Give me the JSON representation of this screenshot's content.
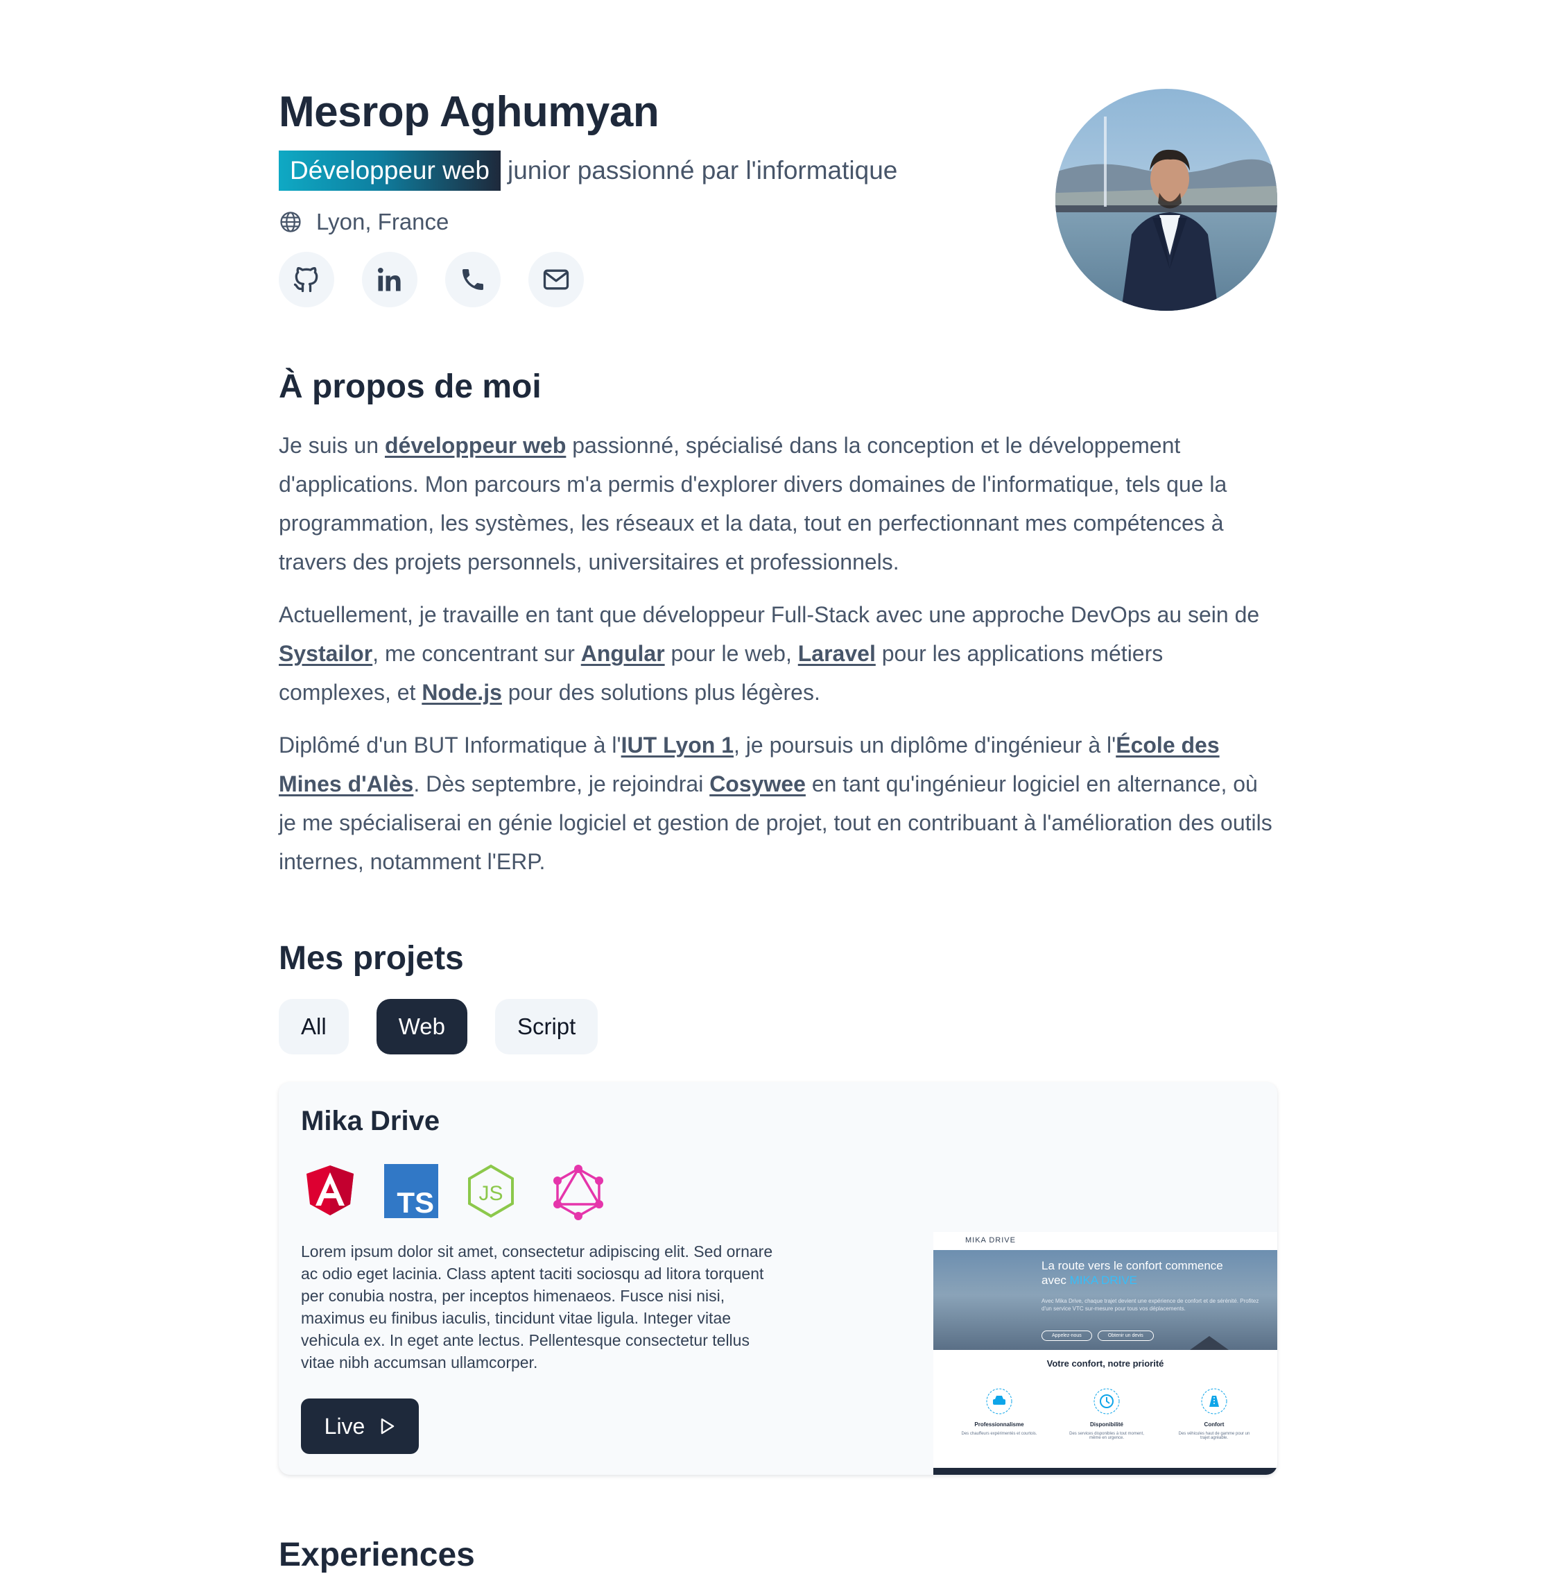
{
  "header": {
    "name": "Mesrop Aghumyan",
    "role_highlight": "Développeur web",
    "role_rest": "junior passionné par l'informatique",
    "location": "Lyon, France"
  },
  "socials": [
    {
      "icon": "github-icon"
    },
    {
      "icon": "linkedin-icon"
    },
    {
      "icon": "phone-icon"
    },
    {
      "icon": "mail-icon"
    }
  ],
  "about": {
    "title": "À propos de moi",
    "p1": {
      "t1": "Je suis un ",
      "l1": "développeur web",
      "t2": " passionné, spécialisé dans la conception et le développement d'applications. Mon parcours m'a permis d'explorer divers domaines de l'informatique, tels que la programmation, les systèmes, les réseaux et la data, tout en perfectionnant mes compétences à travers des projets personnels, universitaires et professionnels."
    },
    "p2": {
      "t1": "Actuellement, je travaille en tant que développeur Full-Stack avec une approche DevOps au sein de ",
      "l1": "Systailor",
      "t2": ", me concentrant sur ",
      "l2": "Angular",
      "t3": " pour le web, ",
      "l3": "Laravel",
      "t4": " pour les applications métiers complexes, et ",
      "l4": "Node.js",
      "t5": " pour des solutions plus légères."
    },
    "p3": {
      "t1": "Diplômé d'un BUT Informatique à l'",
      "l1": "IUT Lyon 1",
      "t2": ", je poursuis un diplôme d'ingénieur à l'",
      "l2": "École des Mines d'Alès",
      "t3": ". Dès septembre, je rejoindrai ",
      "l3": "Cosywee",
      "t4": " en tant qu'ingénieur logiciel en alternance, où je me spécialiserai en génie logiciel et gestion de projet, tout en contribuant à l'amélioration des outils internes, notamment l'ERP."
    }
  },
  "projects": {
    "title": "Mes projets",
    "filters": [
      "All",
      "Web",
      "Script"
    ],
    "active_filter": "Web",
    "card": {
      "title": "Mika Drive",
      "tech_icons": [
        "angular-icon",
        "typescript-icon",
        "nodejs-icon",
        "graphql-icon"
      ],
      "description": "Lorem ipsum dolor sit amet, consectetur adipiscing elit. Sed ornare ac odio eget lacinia. Class aptent taciti sociosqu ad litora torquent per conubia nostra, per inceptos himenaeos. Fusce nisi nisi, maximus eu finibus iaculis, tincidunt vitae ligula. Integer vitae vehicula ex. In eget ante lectus. Pellentesque consectetur tellus vitae nibh accumsan ullamcorper.",
      "live_label": "Live",
      "preview": {
        "logo": "MIKA DRIVE",
        "hero_line1": "La route vers le confort commence",
        "hero_line2_a": "avec ",
        "hero_line2_b": "MIKA DRIVE",
        "hero_text": "Avec Mika Drive, chaque trajet devient une expérience de confort et de sérénité. Profitez d'un service VTC sur-mesure pour tous vos déplacements.",
        "btn1": "Appelez-nous",
        "btn2": "Obtenir un devis",
        "section_title": "Votre confort, notre priorité",
        "features": [
          {
            "title": "Professionnalisme",
            "text": "Des chauffeurs expérimentés et courtois."
          },
          {
            "title": "Disponibilité",
            "text": "Des services disponibles à tout moment, même en urgence."
          },
          {
            "title": "Confort",
            "text": "Des véhicules haut de gamme pour un trajet agréable."
          }
        ]
      }
    }
  },
  "experiences": {
    "title": "Experiences"
  },
  "colors": {
    "primary": "#1e293b",
    "accent": "#0fa9c4",
    "muted": "#475569",
    "chip_bg": "#f1f5f9"
  }
}
